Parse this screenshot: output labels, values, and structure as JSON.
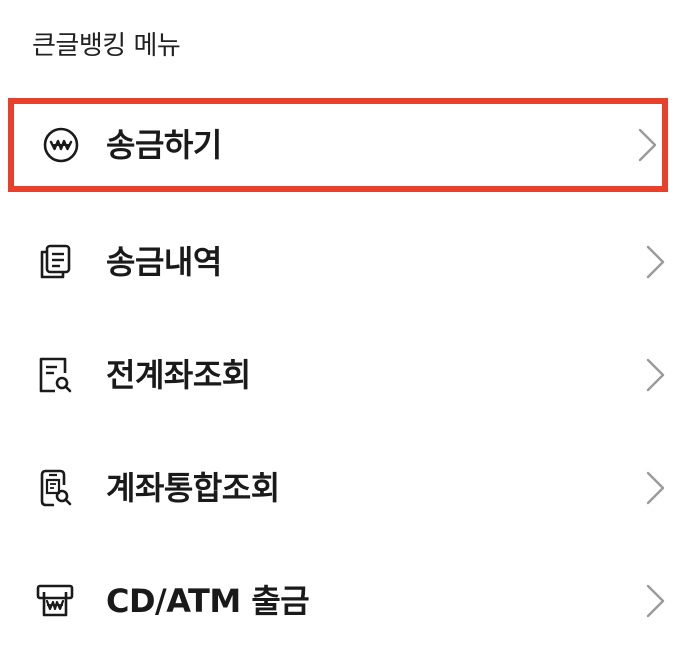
{
  "section": {
    "title": "큰글뱅킹 메뉴"
  },
  "menu": {
    "items": [
      {
        "label": "송금하기",
        "icon": "won-coin-icon",
        "highlighted": true
      },
      {
        "label": "송금내역",
        "icon": "documents-icon"
      },
      {
        "label": "전계좌조회",
        "icon": "document-search-icon"
      },
      {
        "label": "계좌통합조회",
        "icon": "phone-document-search-icon"
      },
      {
        "label": "CD/ATM 출금",
        "icon": "atm-withdraw-icon"
      }
    ]
  },
  "colors": {
    "highlight_border": "#e8402a",
    "text": "#1a1a1a",
    "chevron": "#9a9a9a"
  }
}
